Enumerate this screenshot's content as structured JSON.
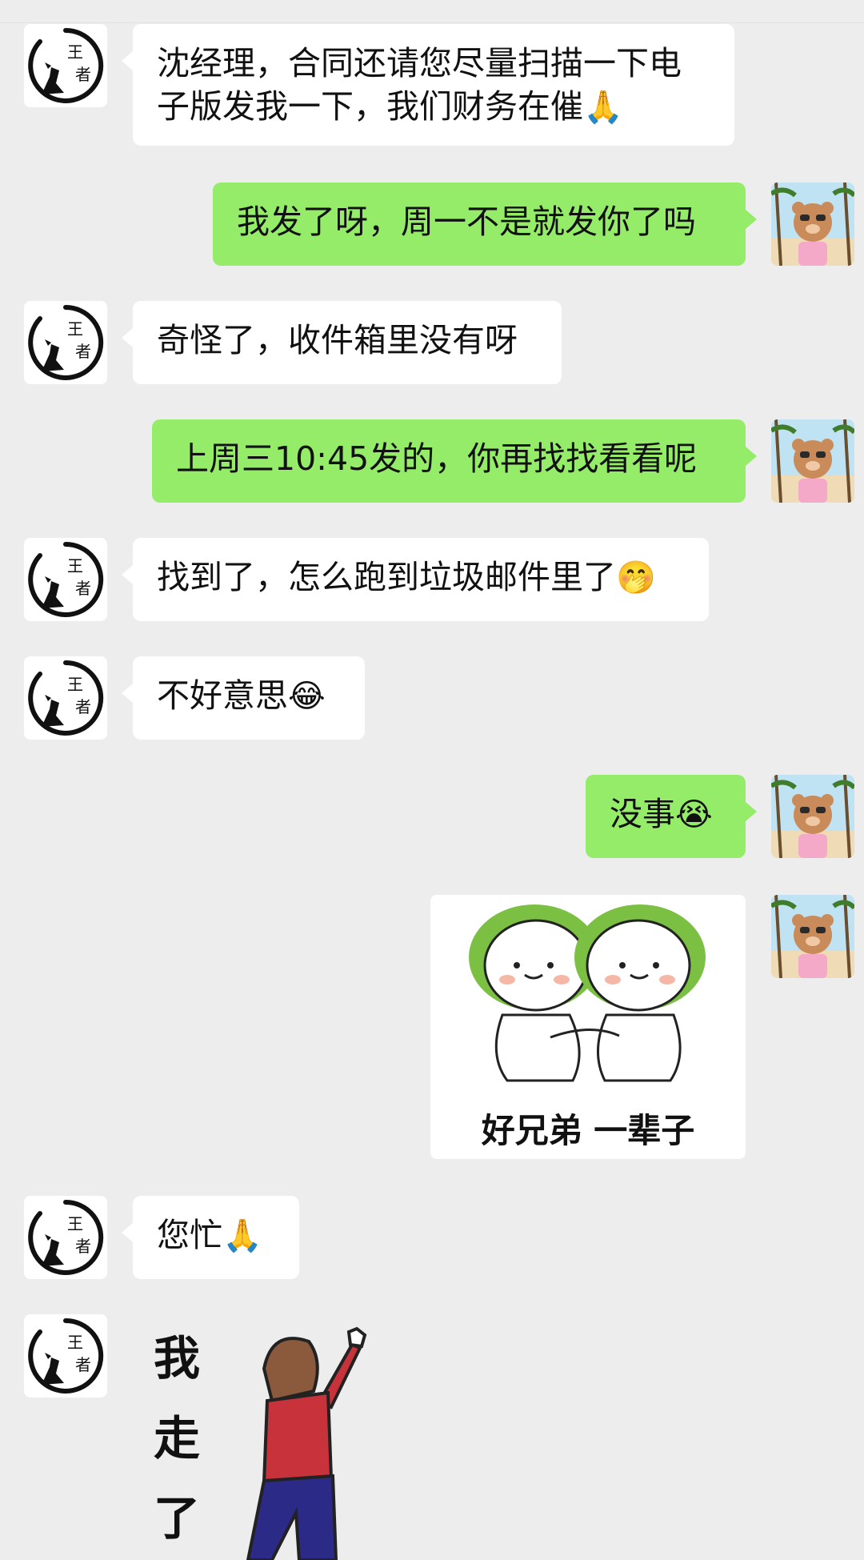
{
  "messages": [
    {
      "side": "left",
      "text": "沈经理，合同还请您尽量扫描一下电",
      "text2": "子版发我一下，我们财务在催",
      "emoji": "🙏"
    },
    {
      "side": "right",
      "text": "我发了呀，周一不是就发你了吗"
    },
    {
      "side": "left",
      "text": "奇怪了，收件箱里没有呀"
    },
    {
      "side": "right",
      "text": "上周三10:45发的，你再找找看看呢"
    },
    {
      "side": "left",
      "text": "找到了，怎么跑到垃圾邮件里了",
      "emoji": "🤭"
    },
    {
      "side": "left",
      "text": "不好意思",
      "emoji": "😂"
    },
    {
      "side": "right",
      "text": "没事",
      "emoji": "😭"
    },
    {
      "side": "right",
      "type": "sticker",
      "caption": "好兄弟 一辈子"
    },
    {
      "side": "left",
      "text": "您忙",
      "emoji": "🙏"
    },
    {
      "side": "left",
      "type": "sticker",
      "caption_chars": [
        "我",
        "走",
        "了"
      ]
    }
  ],
  "avatars": {
    "left_glyphs": [
      "王",
      "者"
    ],
    "colors": {
      "left_bg": "#ffffff",
      "right_sky": "#bfe3f2",
      "right_sand": "#efdcb6"
    }
  },
  "colors": {
    "background": "#ededed",
    "bubble_self": "#95ec69",
    "bubble_other": "#ffffff"
  }
}
